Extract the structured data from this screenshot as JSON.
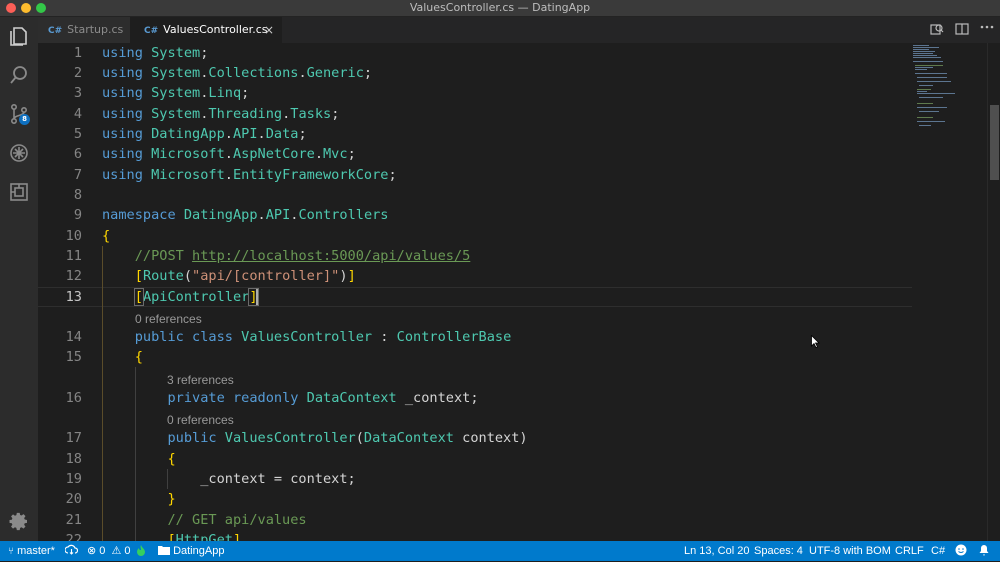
{
  "window": {
    "title": "ValuesController.cs — DatingApp"
  },
  "activity_bar": {
    "scm_badge": "8"
  },
  "tabs": [
    {
      "label": "Startup.cs",
      "icon_text": "C#",
      "active": false
    },
    {
      "label": "ValuesController.cs",
      "icon_text": "C#",
      "active": true,
      "close": "×"
    }
  ],
  "editor": {
    "line_numbers": [
      "1",
      "2",
      "3",
      "4",
      "5",
      "6",
      "7",
      "8",
      "9",
      "10",
      "11",
      "12",
      "13",
      "14",
      "15",
      "16",
      "17",
      "18",
      "19",
      "20",
      "21",
      "22"
    ],
    "current_line": "13",
    "codelens": [
      "0 references",
      "3 references",
      "0 references"
    ]
  },
  "statusbar": {
    "branch": "master*",
    "errors": "0",
    "warnings": "0",
    "project": "DatingApp",
    "position": "Ln 13, Col 20",
    "spaces": "Spaces: 4",
    "encoding": "UTF-8 with BOM",
    "eol": "CRLF",
    "language": "C#"
  },
  "colors": {
    "accent": "#007acc",
    "keyword": "#569cd6",
    "type": "#4ec9b0",
    "string": "#ce9178",
    "comment": "#6a9955",
    "bracket": "#ffd700"
  }
}
